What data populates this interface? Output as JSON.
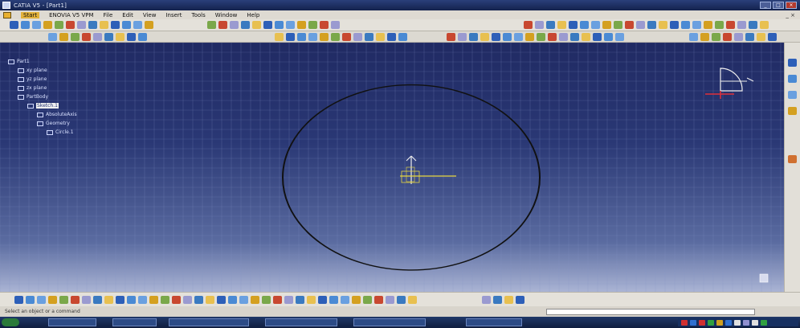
{
  "window": {
    "title": "CATIA V5 - [Part1]",
    "controls": [
      "_",
      "□",
      "×"
    ]
  },
  "menu": {
    "items": [
      "Start",
      "ENOVIA V5 VPM",
      "File",
      "Edit",
      "View",
      "Insert",
      "Tools",
      "Window",
      "Help"
    ],
    "active_index": 0,
    "mdi_controls": "_ ×"
  },
  "spec_tree": {
    "nodes": [
      {
        "label": "Part1",
        "level": 0,
        "selected": false
      },
      {
        "label": "xy plane",
        "level": 1,
        "selected": false
      },
      {
        "label": "yz plane",
        "level": 1,
        "selected": false
      },
      {
        "label": "zx plane",
        "level": 1,
        "selected": false
      },
      {
        "label": "PartBody",
        "level": 1,
        "selected": false
      },
      {
        "label": "Sketch.1",
        "level": 2,
        "selected": true
      },
      {
        "label": "AbsoluteAxis",
        "level": 3,
        "selected": false
      },
      {
        "label": "Geometry",
        "level": 3,
        "selected": false
      },
      {
        "label": "Circle.1",
        "level": 4,
        "selected": false
      }
    ]
  },
  "status": {
    "message": "Select an object or a command"
  },
  "colors": {
    "sketch_circle": "#111111",
    "axis_h": "#e8d840",
    "axis_v": "#f0f0f0",
    "compass": "#f0f0f0",
    "compass_axis": "#e0303a"
  },
  "icons": {
    "toolbar_top": [
      "sketcher-icon",
      "workbench-icon",
      "save-icon",
      "print-icon",
      "cut-icon",
      "copy-icon",
      "paste-icon",
      "undo-icon",
      "redo-icon",
      "help-icon",
      "fly-icon",
      "pan-icon",
      "rotate-icon",
      "zoom-in-icon",
      "zoom-out-icon",
      "normal-view-icon",
      "fit-all-icon",
      "render-icon",
      "hide-show-icon",
      "swap-icon",
      "profile-icon",
      "line-icon",
      "arc-icon",
      "circle-icon",
      "spline-icon"
    ],
    "toolbar_bottom": [
      "exit-workbench-icon",
      "grid-icon",
      "snap-icon",
      "construction-icon",
      "constraint-icon",
      "dimension-icon",
      "trim-icon",
      "mirror-icon",
      "project-icon",
      "chamfer-icon",
      "corner-icon",
      "quick-trim-icon",
      "analysis-icon"
    ]
  }
}
